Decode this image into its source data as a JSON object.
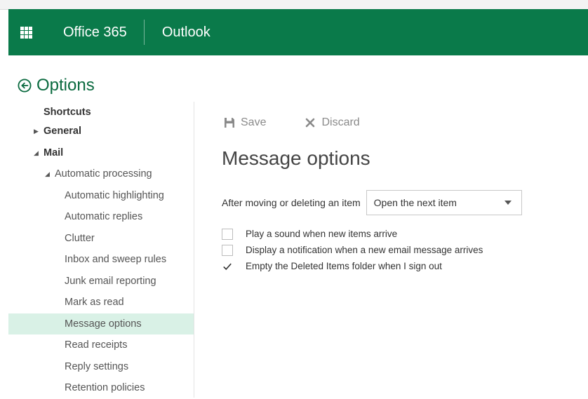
{
  "topbar": {
    "app_name": "Office 365",
    "product": "Outlook",
    "color": "#0a7a4a"
  },
  "options": {
    "title": "Options"
  },
  "nav": {
    "items": [
      {
        "label": "Shortcuts",
        "level": 0,
        "expander": "none"
      },
      {
        "label": "General",
        "level": 0,
        "expander": "collapsed"
      },
      {
        "label": "Mail",
        "level": 0,
        "expander": "expanded"
      },
      {
        "label": "Automatic processing",
        "level": 1,
        "expander": "expanded"
      },
      {
        "label": "Automatic highlighting",
        "level": 2
      },
      {
        "label": "Automatic replies",
        "level": 2
      },
      {
        "label": "Clutter",
        "level": 2
      },
      {
        "label": "Inbox and sweep rules",
        "level": 2
      },
      {
        "label": "Junk email reporting",
        "level": 2
      },
      {
        "label": "Mark as read",
        "level": 2
      },
      {
        "label": "Message options",
        "level": 2,
        "selected": true
      },
      {
        "label": "Read receipts",
        "level": 2
      },
      {
        "label": "Reply settings",
        "level": 2
      },
      {
        "label": "Retention policies",
        "level": 2
      }
    ],
    "selected_color": "#d9f1e6"
  },
  "toolbar": {
    "save_label": "Save",
    "discard_label": "Discard"
  },
  "main": {
    "title": "Message options",
    "after_moving_label": "After moving or deleting an item",
    "after_moving_value": "Open the next item",
    "checkboxes": [
      {
        "label": "Play a sound when new items arrive",
        "checked": false
      },
      {
        "label": "Display a notification when a new email message arrives",
        "checked": false
      },
      {
        "label": "Empty the Deleted Items folder when I sign out",
        "checked": true
      }
    ]
  }
}
